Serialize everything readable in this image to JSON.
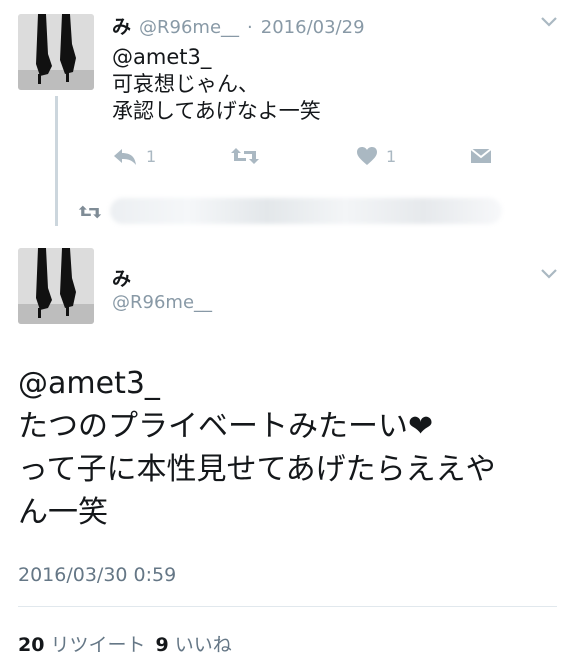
{
  "tweet1": {
    "display_name": "み",
    "handle": "@R96me__",
    "separator": "·",
    "date": "2016/03/29",
    "lines": [
      "@amet3_",
      "可哀想じゃん、",
      "承認してあげなよ一笑"
    ],
    "reply_count": "1",
    "like_count": "1"
  },
  "retweet_row": {
    "icon": "retweet-icon"
  },
  "tweet2": {
    "display_name": "み",
    "handle": "@R96me__",
    "lines": [
      "@amet3_",
      "たつのプライベートみたーい❤",
      "って子に本性見せてあげたらええや",
      "ん一笑"
    ],
    "timestamp": "2016/03/30 0:59",
    "retweet_count": "20",
    "retweet_label": "リツイート",
    "like_count": "9",
    "like_label": "いいね"
  },
  "colors": {
    "icon_gray": "#aab8c2",
    "meta_gray": "#8899a6",
    "text": "#14171a"
  }
}
